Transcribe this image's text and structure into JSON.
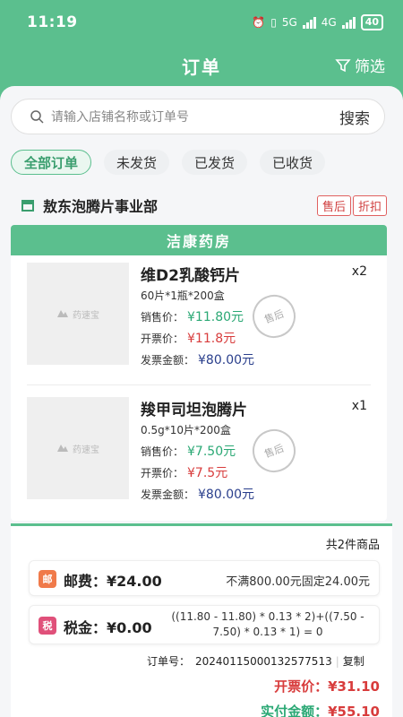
{
  "status_bar": {
    "time": "11:19",
    "net1": "5G",
    "net2": "4G",
    "battery": "40"
  },
  "nav": {
    "title": "订单",
    "filter_label": "筛选"
  },
  "search": {
    "placeholder": "请输入店铺名称或订单号",
    "button": "搜索"
  },
  "tabs": [
    {
      "label": "全部订单",
      "active": true
    },
    {
      "label": "未发货",
      "active": false
    },
    {
      "label": "已发货",
      "active": false
    },
    {
      "label": "已收货",
      "active": false
    }
  ],
  "shop": {
    "name": "敖东泡腾片事业部",
    "badges": [
      "售后",
      "折扣"
    ]
  },
  "pharmacy": {
    "name": "洁康药房"
  },
  "products": [
    {
      "name": "维D2乳酸钙片",
      "qty": "x2",
      "spec": "60片*1瓶*200盒",
      "sale_label": "销售价：",
      "sale_price": "¥11.80元",
      "invoice_label": "开票价：",
      "invoice_price": "¥11.8元",
      "amount_label": "发票金额：",
      "amount": "¥80.00元",
      "stamp": "售后",
      "thumb_logo": "药速宝"
    },
    {
      "name": "羧甲司坦泡腾片",
      "qty": "x1",
      "spec": "0.5g*10片*200盒",
      "sale_label": "销售价：",
      "sale_price": "¥7.50元",
      "invoice_label": "开票价：",
      "invoice_price": "¥7.5元",
      "amount_label": "发票金额：",
      "amount": "¥80.00元",
      "stamp": "售后",
      "thumb_logo": "药速宝"
    }
  ],
  "summary": {
    "total_items": "共2件商品",
    "shipping_label": "邮费：¥24.00",
    "shipping_note": "不满800.00元固定24.00元",
    "tax_label": "税金：¥0.00",
    "tax_formula": "((11.80 - 11.80) * 0.13 * 2)+((7.50 - 7.50) * 0.13 * 1) = 0",
    "order_no_label": "订单号：",
    "order_no": "20240115000132577513",
    "copy": "复制",
    "invoice_total_label": "开票价：",
    "invoice_total": "¥31.10",
    "paid_label": "实付金额：",
    "paid_total": "¥55.10"
  },
  "colors": {
    "brand_green": "#5bbf8e",
    "price_green": "#2aa874",
    "price_red": "#d83c3c",
    "amount_blue": "#2a3f8c"
  }
}
